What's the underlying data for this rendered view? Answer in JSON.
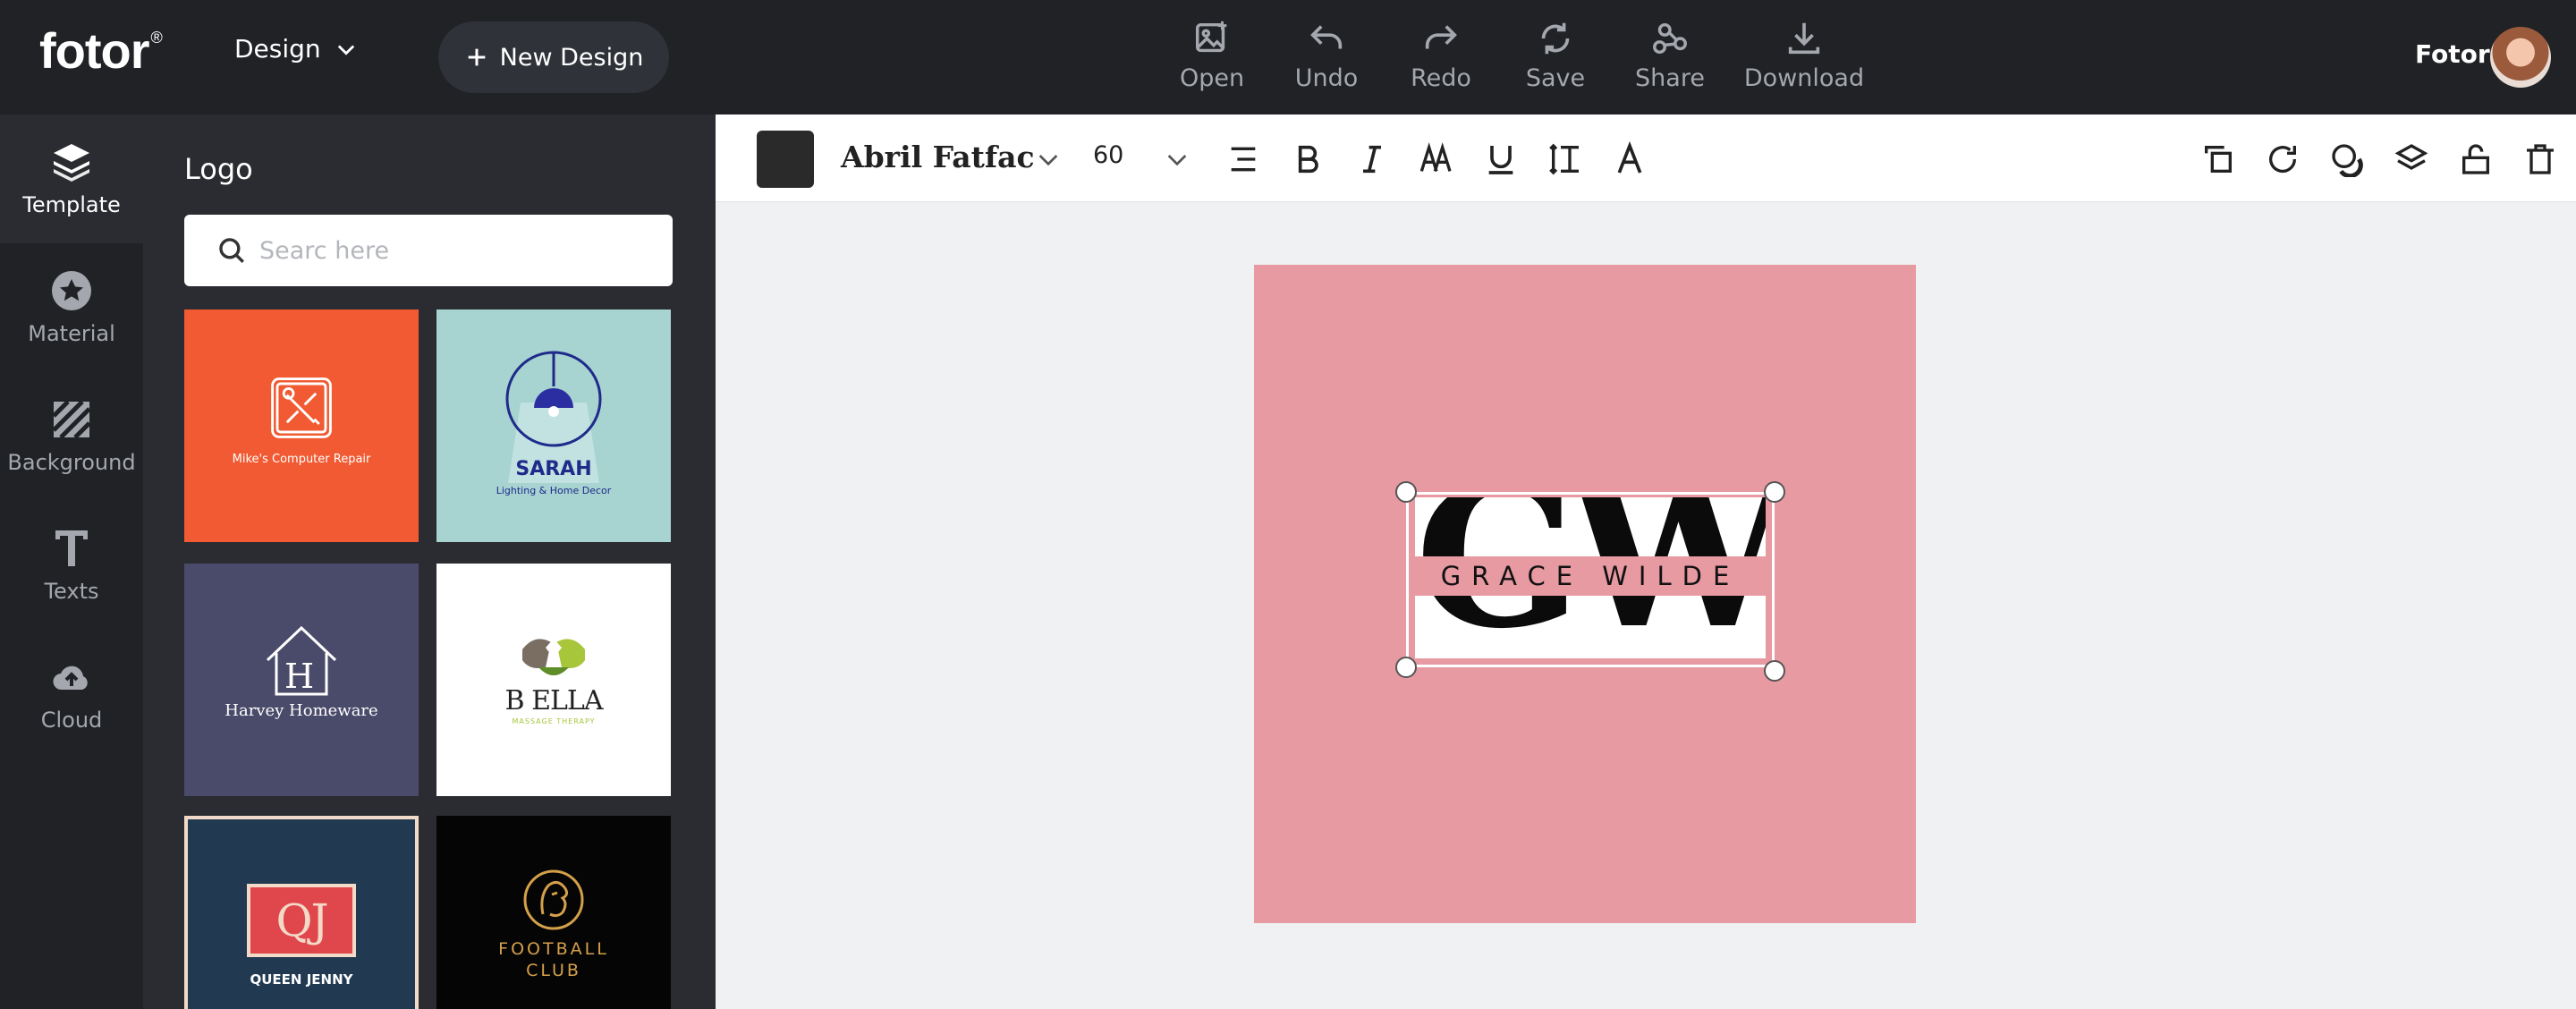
{
  "topbar": {
    "brand": "fotor",
    "brand_mark": "®",
    "design_menu": "Design",
    "new_design": "New Design",
    "tools": [
      {
        "label": "Open",
        "icon": "open-image-icon"
      },
      {
        "label": "Undo",
        "icon": "undo-icon"
      },
      {
        "label": "Redo",
        "icon": "redo-icon"
      },
      {
        "label": "Save",
        "icon": "save-icon"
      },
      {
        "label": "Share",
        "icon": "share-icon"
      },
      {
        "label": "Download",
        "icon": "download-icon"
      }
    ],
    "user_name": "Fotor"
  },
  "rail": {
    "items": [
      {
        "label": "Template",
        "icon": "layers-icon",
        "active": true
      },
      {
        "label": "Material",
        "icon": "star-icon"
      },
      {
        "label": "Background",
        "icon": "stripes-icon"
      },
      {
        "label": "Texts",
        "icon": "text-t-icon"
      },
      {
        "label": "Cloud",
        "icon": "cloud-upload-icon"
      }
    ]
  },
  "panel": {
    "title": "Logo",
    "search_placeholder": "Searc here",
    "templates": [
      {
        "text": "Mike's Computer Repair",
        "bg": "#f15a32"
      },
      {
        "text": "SARAH",
        "subtext": "Lighting & Home Decor",
        "bg": "#a7d3d1"
      },
      {
        "text": "Harvey Homeware",
        "monogram": "H",
        "bg": "#4a4a6a"
      },
      {
        "text": "B ELLA",
        "subtext": "MASSAGE THERAPY",
        "bg": "#ffffff"
      },
      {
        "text": "QUEEN JENNY",
        "monogram": "QJ",
        "bg": "#213a52"
      },
      {
        "text": "FOOTBALL",
        "subtext": "CLUB",
        "bg": "#050505"
      }
    ]
  },
  "texttoolbar": {
    "color": "#2a2a2a",
    "font": "Abril Fatfac",
    "size": "60"
  },
  "canvas": {
    "background": "#e89aa2",
    "monogram": "GW",
    "name": "GRACE WILDE"
  }
}
